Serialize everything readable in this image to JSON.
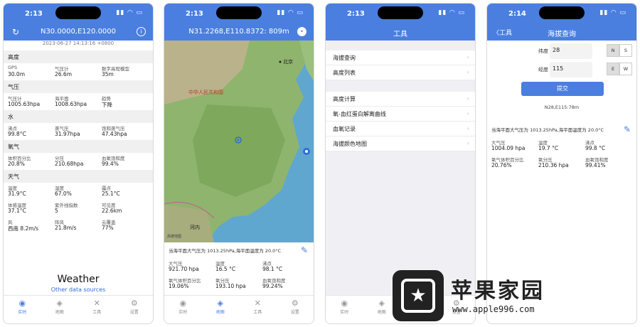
{
  "phones": [
    {
      "time": "2:13",
      "title": "N30.0000,E120.0000"
    },
    {
      "time": "2:13",
      "title": "N31.2268,E110.8372: 809m"
    },
    {
      "time": "2:13",
      "title": "工具"
    },
    {
      "time": "2:14",
      "title": "海拔查询",
      "back": "工具"
    }
  ],
  "tabs": [
    "实时",
    "地图",
    "工具",
    "设置"
  ],
  "screen1": {
    "timestamp": "2023-06-27 14:13:16 +0800",
    "sections": [
      {
        "title": "高度",
        "rows": [
          [
            {
              "l": "GPS",
              "v": "30.0m"
            },
            {
              "l": "气压计",
              "v": "26.6m"
            },
            {
              "l": "数字高程模型",
              "v": "35m"
            }
          ]
        ]
      },
      {
        "title": "气压",
        "rows": [
          [
            {
              "l": "气压计",
              "v": "1005.63hpa"
            },
            {
              "l": "海平面",
              "v": "1008.63hpa"
            },
            {
              "l": "趋势",
              "v": "下降"
            }
          ]
        ]
      },
      {
        "title": "水",
        "rows": [
          [
            {
              "l": "沸点",
              "v": "99.8°C"
            },
            {
              "l": "蒸气压",
              "v": "31.97hpa"
            },
            {
              "l": "饱和蒸气压",
              "v": "47.43hpa"
            }
          ]
        ]
      },
      {
        "title": "氧气",
        "rows": [
          [
            {
              "l": "体积百分比",
              "v": "20.8%"
            },
            {
              "l": "分压",
              "v": "210.68hpa"
            },
            {
              "l": "血氧饱和度",
              "v": "99.4%"
            }
          ]
        ]
      },
      {
        "title": "天气",
        "rows": [
          [
            {
              "l": "温度",
              "v": "31.9°C"
            },
            {
              "l": "湿度",
              "v": "67.0%"
            },
            {
              "l": "露点",
              "v": "25.1°C"
            }
          ],
          [
            {
              "l": "体感温度",
              "v": "37.1°C"
            },
            {
              "l": "紫外线指数",
              "v": "5"
            },
            {
              "l": "可见度",
              "v": "22.6km"
            }
          ],
          [
            {
              "l": "风",
              "v": "西南 8.2m/s"
            },
            {
              "l": "阵风",
              "v": "21.8m/s"
            },
            {
              "l": "云覆盖",
              "v": "77%"
            }
          ]
        ]
      }
    ],
    "weather_logo": " Weather",
    "weather_link": "Other data sources"
  },
  "screen2": {
    "map_labels": {
      "beijing": "北京",
      "china": "中华人民共和国",
      "hanoi": "河内",
      "credit": "高德地图"
    },
    "note": "当海平面大气压为 1013.25hPa,海平面温度为 20.0°C",
    "rows": [
      [
        {
          "l": "大气压",
          "v": "921.70 hpa"
        },
        {
          "l": "温度",
          "v": "16.5 °C"
        },
        {
          "l": "沸点",
          "v": "98.1 °C"
        }
      ],
      [
        {
          "l": "氧气体积百分比",
          "v": "19.06%"
        },
        {
          "l": "氧分压",
          "v": "193.10 hpa"
        },
        {
          "l": "血氧饱和度",
          "v": "99.24%"
        }
      ]
    ]
  },
  "screen3": {
    "group1": [
      "海拔查询",
      "高度列表"
    ],
    "group2": [
      "高度计算",
      "氧-血红蛋白解离曲线",
      "血氧记录",
      "海拔颜色地图"
    ]
  },
  "screen4": {
    "lat_label": "纬度",
    "lat_value": "28",
    "lon_label": "经度",
    "lon_value": "115",
    "ns": [
      "N",
      "S"
    ],
    "ew": [
      "E",
      "W"
    ],
    "submit": "提交",
    "coord": "N28,E115:78m",
    "note": "当海平面大气压为 1013.25hPa,海平面温度为 20.0°C",
    "rows": [
      [
        {
          "l": "大气压",
          "v": "1004.09 hpa"
        },
        {
          "l": "温度",
          "v": "19.7 °C"
        },
        {
          "l": "沸点",
          "v": "99.8 °C"
        }
      ],
      [
        {
          "l": "氧气体积百分比",
          "v": "20.76%"
        },
        {
          "l": "氧分压",
          "v": "210.36 hpa"
        },
        {
          "l": "血氧饱和度",
          "v": "99.41%"
        }
      ]
    ]
  },
  "watermark": {
    "text": "苹果家园",
    "url": "www.apple996.com"
  },
  "colors": {
    "accent": "#4a7fe0"
  }
}
